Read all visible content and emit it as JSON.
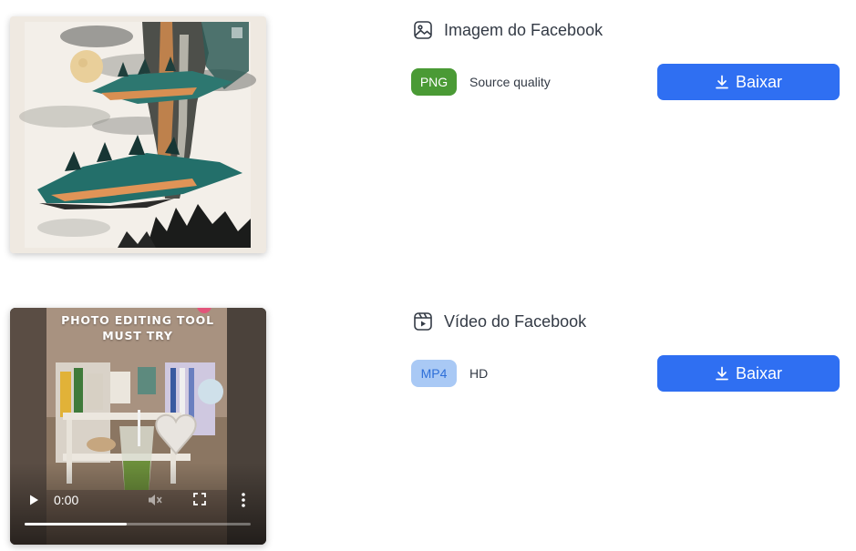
{
  "items": [
    {
      "kind": "image",
      "title": "Imagem do Facebook",
      "icon": "image-icon",
      "format": "PNG",
      "quality": "Source quality",
      "button_label": "Baixar",
      "button_icon": "download-icon"
    },
    {
      "kind": "video",
      "title": "Vídeo do Facebook",
      "icon": "video-play-icon",
      "format": "MP4",
      "quality": "HD",
      "button_label": "Baixar",
      "button_icon": "download-icon",
      "preview": {
        "overlay_line1": "PHOTO EDITING TOOL",
        "overlay_line2": "MUST TRY",
        "current_time": "0:00",
        "progress": 0.45
      }
    }
  ],
  "colors": {
    "primary_button": "#2f6ff2",
    "png_badge": "#4a9a35",
    "mp4_badge_bg": "#a9c9f5",
    "mp4_badge_text": "#2e6fd8",
    "text": "#333a45"
  }
}
